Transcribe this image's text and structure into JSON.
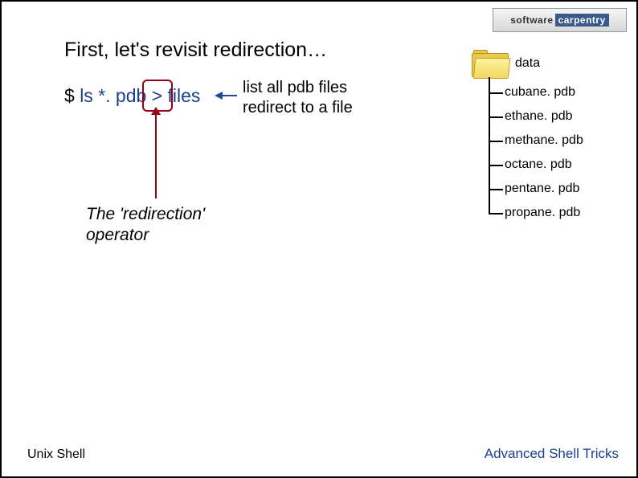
{
  "logo": {
    "left": "software",
    "right": "carpentry"
  },
  "heading": "First, let's revisit redirection…",
  "command": {
    "prompt": "$",
    "text": "ls *. pdb > files"
  },
  "explain": {
    "line1": "list all pdb files",
    "line2": "redirect to a file"
  },
  "caption": {
    "line1": "The 'redirection'",
    "line2": "operator"
  },
  "tree": {
    "folder": "data",
    "files": [
      "cubane. pdb",
      "ethane. pdb",
      "methane. pdb",
      "octane. pdb",
      "pentane. pdb",
      "propane. pdb"
    ]
  },
  "footer": {
    "left": "Unix Shell",
    "right": "Advanced Shell Tricks"
  }
}
